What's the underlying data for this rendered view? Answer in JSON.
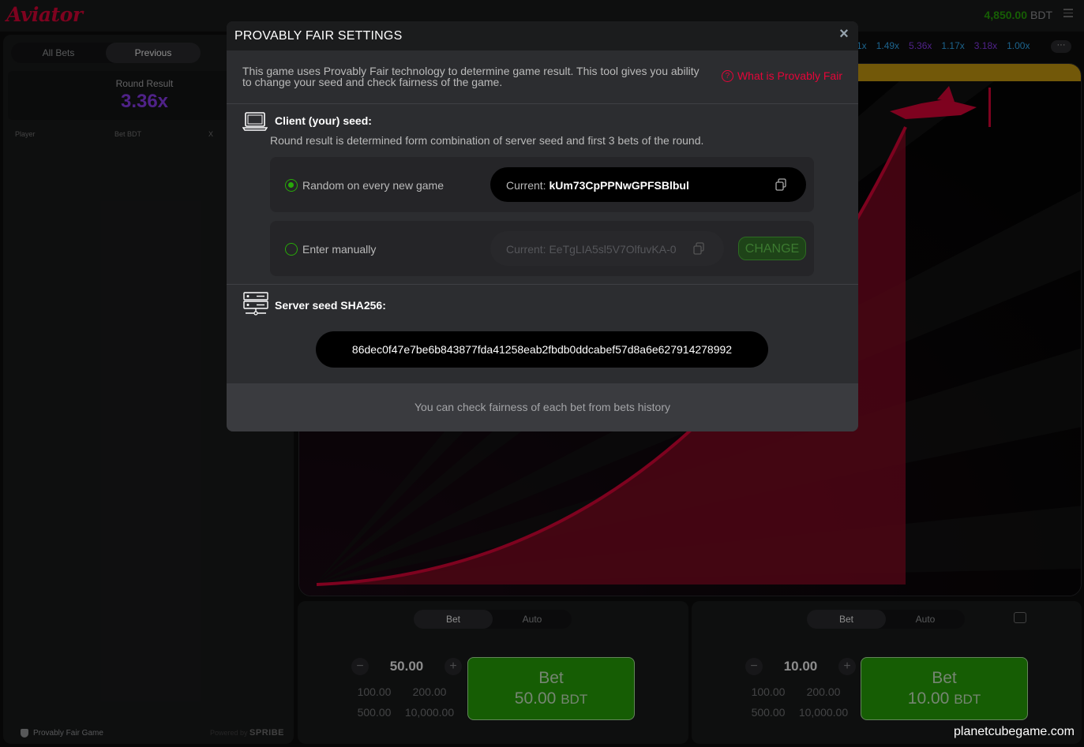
{
  "header": {
    "logo": "Aviator",
    "balance_amount": "4,850.00",
    "balance_currency": "BDT",
    "menu_icon": "hamburger-icon"
  },
  "left_panel": {
    "tabs": [
      {
        "label": "All Bets",
        "active": false
      },
      {
        "label": "Previous",
        "active": true
      }
    ],
    "round_result_label": "Round Result",
    "round_result_value": "3.36x",
    "columns": {
      "player": "Player",
      "bet": "Bet BDT",
      "x": "X"
    },
    "footer_pf": "Provably Fair Game",
    "footer_powered": "Powered by",
    "footer_brand": "SPRIBE"
  },
  "multipliers": [
    {
      "value": "1x",
      "color": "#34b4ff"
    },
    {
      "value": "1.49x",
      "color": "#34b4ff"
    },
    {
      "value": "5.36x",
      "color": "#913ef8"
    },
    {
      "value": "1.17x",
      "color": "#34b4ff"
    },
    {
      "value": "3.18x",
      "color": "#913ef8"
    },
    {
      "value": "1.00x",
      "color": "#34b4ff"
    }
  ],
  "more_label": "···",
  "bet_panels": [
    {
      "tabs": [
        "Bet",
        "Auto"
      ],
      "amount": "50.00",
      "quick": [
        "100.00",
        "200.00",
        "500.00",
        "10,000.00"
      ],
      "bet_label": "Bet",
      "bet_amount": "50.00",
      "bet_currency": "BDT"
    },
    {
      "tabs": [
        "Bet",
        "Auto"
      ],
      "amount": "10.00",
      "quick": [
        "100.00",
        "200.00",
        "500.00",
        "10,000.00"
      ],
      "bet_label": "Bet",
      "bet_amount": "10.00",
      "bet_currency": "BDT"
    }
  ],
  "watermark": "planetcubegame.com",
  "modal": {
    "title": "PROVABLY FAIR SETTINGS",
    "close": "×",
    "intro": "This game uses Provably Fair technology to determine game result. This tool gives you ability to change your seed and check fairness of the game.",
    "what_link": "What is Provably Fair",
    "client": {
      "title": "Client (your) seed:",
      "desc": "Round result is determined form combination of server seed and first 3 bets of the round.",
      "random_label": "Random on every new game",
      "random_current_prefix": "Current:",
      "random_current_value": "kUm73CpPPNwGPFSBlbul",
      "manual_label": "Enter manually",
      "manual_current_prefix": "Current:",
      "manual_current_value": "EeTgLIA5sl5V7OlfuvKA-0",
      "change_label": "CHANGE"
    },
    "server": {
      "title": "Server seed SHA256:",
      "hash": "86dec0f47e7be6b843877fda41258eab2fbdb0ddcabef57d8a6e627914278992"
    },
    "footer": "You can check fairness of each bet from bets history"
  },
  "colors": {
    "accent_red": "#e50539",
    "green": "#28a909",
    "blue": "#34b4ff",
    "purple": "#913ef8"
  }
}
